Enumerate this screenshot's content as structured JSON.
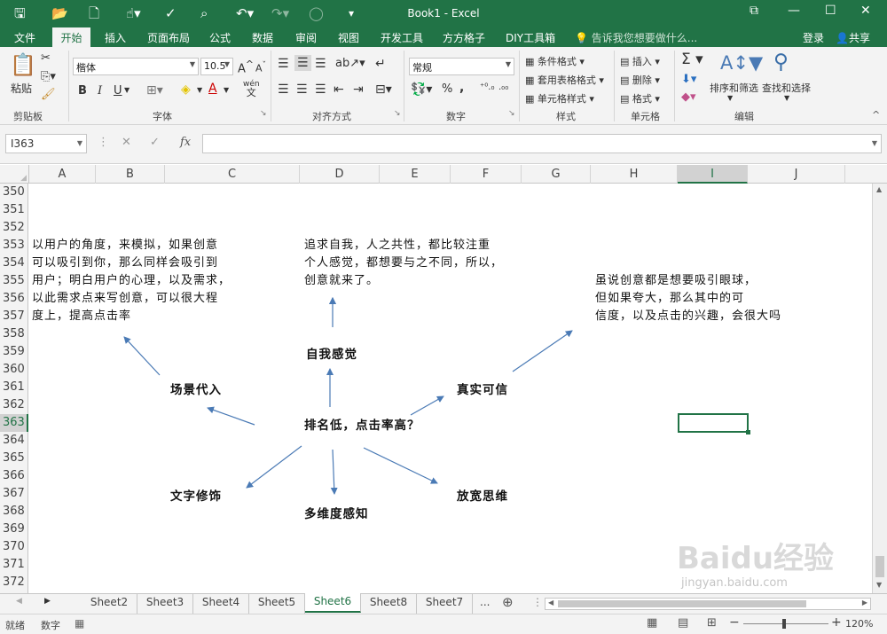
{
  "titlebar": {
    "title": "Book1 - Excel",
    "win_restore": "⧉",
    "win_min": "—",
    "win_max": "☐",
    "win_close": "✕"
  },
  "ribbon_tabs": [
    "文件",
    "开始",
    "插入",
    "页面布局",
    "公式",
    "数据",
    "审阅",
    "视图",
    "开发工具",
    "方方格子",
    "DIY工具箱"
  ],
  "tellme": "告诉我您想要做什么...",
  "login": "登录",
  "share": "共享",
  "clipboard": {
    "paste": "粘贴",
    "group": "剪贴板"
  },
  "font": {
    "name": "楷体",
    "size": "10.5",
    "group": "字体",
    "bold": "B",
    "italic": "I",
    "underline": "U",
    "wen": "wén",
    "wen2": "文"
  },
  "alignment": {
    "group": "对齐方式"
  },
  "number": {
    "format": "常规",
    "group": "数字",
    "percent": "%",
    "comma": ","
  },
  "styles": {
    "cond": "条件格式",
    "table": "套用表格格式",
    "cell": "单元格样式",
    "group": "样式"
  },
  "cells": {
    "insert": "插入",
    "delete": "删除",
    "format": "格式",
    "group": "单元格"
  },
  "editing": {
    "sort": "排序和筛选",
    "find": "查找和选择",
    "group": "编辑",
    "sigma": "Σ"
  },
  "formulabar": {
    "namebox": "I363",
    "fx": "fx"
  },
  "columns": [
    {
      "label": "A",
      "w": 75
    },
    {
      "label": "B",
      "w": 78
    },
    {
      "label": "C",
      "w": 152
    },
    {
      "label": "D",
      "w": 90
    },
    {
      "label": "E",
      "w": 80
    },
    {
      "label": "F",
      "w": 80
    },
    {
      "label": "G",
      "w": 78
    },
    {
      "label": "H",
      "w": 98
    },
    {
      "label": "I",
      "w": 79
    },
    {
      "label": "J",
      "w": 110
    }
  ],
  "rows": [
    "350",
    "351",
    "352",
    "353",
    "354",
    "355",
    "356",
    "357",
    "358",
    "359",
    "360",
    "361",
    "362",
    "363",
    "364",
    "365",
    "366",
    "367",
    "368",
    "369",
    "370",
    "371",
    "372"
  ],
  "mindmap": {
    "center": "排名低，点击率高？",
    "scene": "场景代入",
    "self": "自我感觉",
    "real": "真实可信",
    "text": "文字修饰",
    "multi": "多维度感知",
    "wide": "放宽思维",
    "note_left": "以用户的角度，来模拟，如果创意\n可以吸引到你，那么同样会吸引到\n用户；明白用户的心理，以及需求，\n以此需求点来写创意，可以很大程\n度上，提高点击率",
    "note_mid": "追求自我，人之共性，都比较注重\n个人感觉，都想要与之不同，所以，\n创意就来了。",
    "note_right": "虽说创意都是想要吸引眼球，\n但如果夸大，那么其中的可\n信度，以及点击的兴趣，会很大吗"
  },
  "sheets": [
    "Sheet2",
    "Sheet3",
    "Sheet4",
    "Sheet5",
    "Sheet6",
    "Sheet8",
    "Sheet7"
  ],
  "active_sheet": "Sheet6",
  "more_sheets": "...",
  "status": {
    "ready": "就绪",
    "numlock": "数字",
    "zoom": "120%"
  },
  "watermark": "Baidu经验",
  "watermark_sub": "jingyan.baidu.com",
  "colors": {
    "excel_green": "#217346",
    "arrow": "#4a7ab5"
  }
}
